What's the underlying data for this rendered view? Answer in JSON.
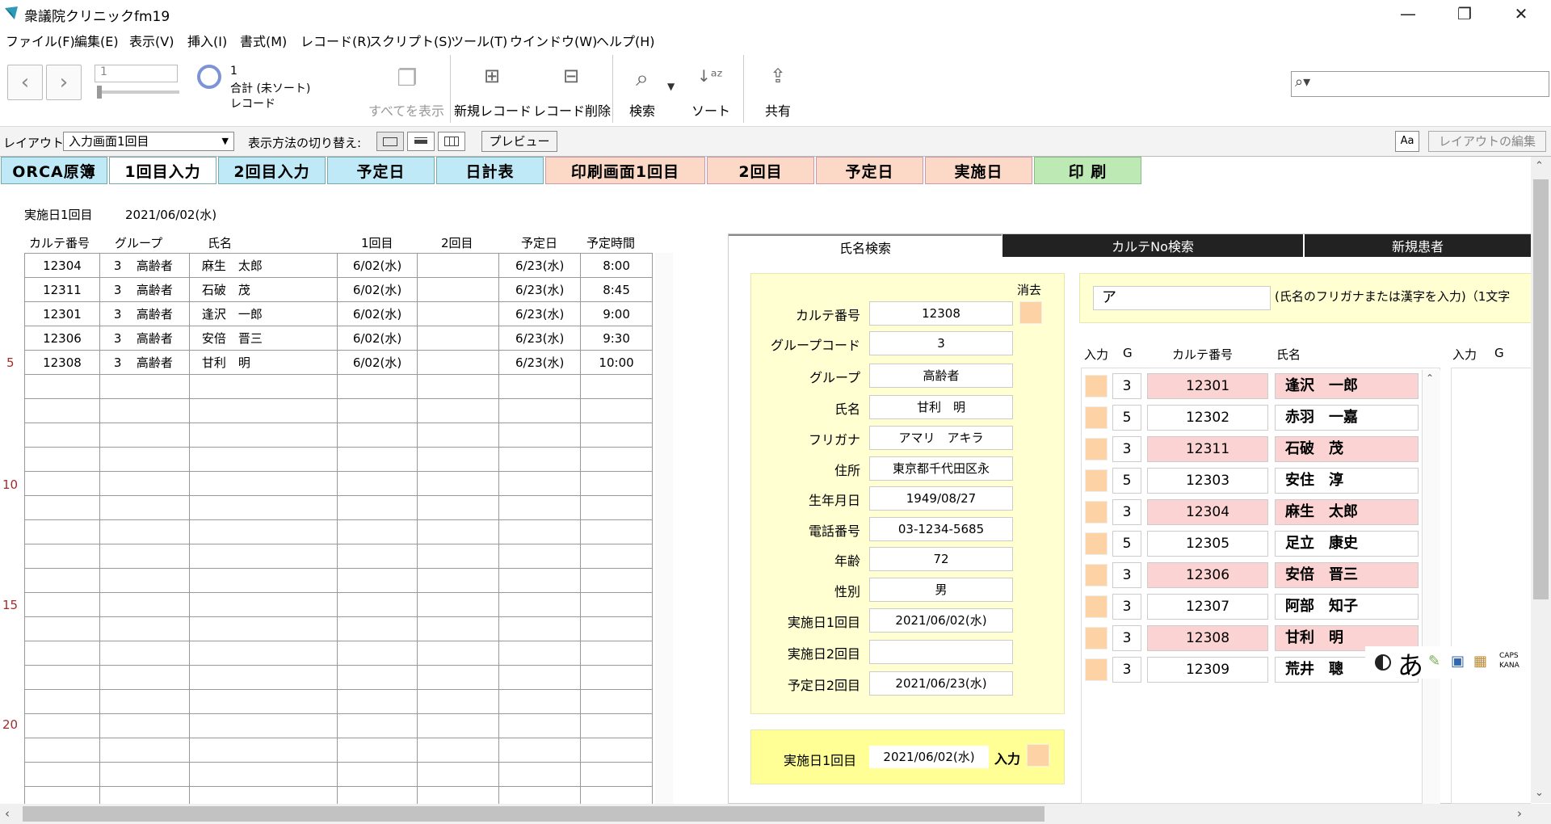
{
  "window": {
    "title": "衆議院クリニックfm19",
    "minimize": "—",
    "restore": "❐",
    "close": "✕"
  },
  "menu": [
    "ファイル(F)",
    "編集(E)",
    "表示(V)",
    "挿入(I)",
    "書式(M)",
    "レコード(R)",
    "スクリプト(S)",
    "ツール(T)",
    "ウインドウ(W)",
    "ヘルプ(H)"
  ],
  "toolbar": {
    "record_number": "1",
    "found_count": "1",
    "found_label": "合計 (未ソート)",
    "record_label": "レコード",
    "show_all": "すべてを表示",
    "new_record": "新規レコード",
    "delete_record": "レコード削除",
    "find": "検索",
    "sort": "ソート",
    "share": "共有",
    "search_placeholder": ""
  },
  "layoutbar": {
    "layout_label": "レイアウト:",
    "layout_value": "入力画面1回目",
    "view_switch_label": "表示方法の切り替え:",
    "preview": "プレビュー",
    "aa": "Aa",
    "edit_layout": "レイアウトの編集"
  },
  "nav_tabs": [
    "ORCA原簿",
    "1回目入力",
    "2回目入力",
    "予定日",
    "日計表",
    "印刷画面1回目",
    "2回目",
    "予定日",
    "実施日",
    "印 刷"
  ],
  "left": {
    "date_label": "実施日1回目",
    "date_value": "2021/06/02(水)",
    "headers": [
      "カルテ番号",
      "グループ",
      "氏名",
      "1回目",
      "2回目",
      "予定日",
      "予定時間"
    ],
    "rows": [
      {
        "karte": "12304",
        "g": "3",
        "group": "高齢者",
        "name": "麻生　太郎",
        "d1": "6/02(水)",
        "d2": "",
        "plan": "6/23(水)",
        "time": "8:00"
      },
      {
        "karte": "12311",
        "g": "3",
        "group": "高齢者",
        "name": "石破　茂",
        "d1": "6/02(水)",
        "d2": "",
        "plan": "6/23(水)",
        "time": "8:45"
      },
      {
        "karte": "12301",
        "g": "3",
        "group": "高齢者",
        "name": "逢沢　一郎",
        "d1": "6/02(水)",
        "d2": "",
        "plan": "6/23(水)",
        "time": "9:00"
      },
      {
        "karte": "12306",
        "g": "3",
        "group": "高齢者",
        "name": "安倍　晋三",
        "d1": "6/02(水)",
        "d2": "",
        "plan": "6/23(水)",
        "time": "9:30"
      },
      {
        "karte": "12308",
        "g": "3",
        "group": "高齢者",
        "name": "甘利　明",
        "d1": "6/02(水)",
        "d2": "",
        "plan": "6/23(水)",
        "time": "10:00"
      }
    ],
    "row_numbers": [
      "5",
      "10",
      "15",
      "20"
    ]
  },
  "panel_tabs": [
    "氏名検索",
    "カルテNo検索",
    "新規患者"
  ],
  "form": {
    "clear_label": "消去",
    "fields": [
      {
        "label": "カルテ番号",
        "value": "12308"
      },
      {
        "label": "グループコード",
        "value": "3"
      },
      {
        "label": "グループ",
        "value": "高齢者"
      },
      {
        "label": "氏名",
        "value": "甘利　明"
      },
      {
        "label": "フリガナ",
        "value": "アマリ　アキラ"
      },
      {
        "label": "住所",
        "value": "東京都千代田区永"
      },
      {
        "label": "生年月日",
        "value": "1949/08/27"
      },
      {
        "label": "電話番号",
        "value": "03-1234-5685"
      },
      {
        "label": "年齢",
        "value": "72"
      },
      {
        "label": "性別",
        "value": "男"
      },
      {
        "label": "実施日1回目",
        "value": "2021/06/02(水)"
      },
      {
        "label": "実施日2回目",
        "value": ""
      },
      {
        "label": "予定日2回目",
        "value": "2021/06/23(水)"
      }
    ],
    "bottom_label": "実施日1回目",
    "bottom_value": "2021/06/02(水)",
    "bottom_input": "入力"
  },
  "search": {
    "value": "ア",
    "hint": "(氏名のフリガナまたは漢字を入力)（1文字",
    "headers": [
      "入力",
      "G",
      "カルテ番号",
      "氏名"
    ],
    "headers2": [
      "入力",
      "G"
    ],
    "rows": [
      {
        "g": "3",
        "karte": "12301",
        "name": "逢沢　一郎",
        "hl": true
      },
      {
        "g": "5",
        "karte": "12302",
        "name": "赤羽　一嘉",
        "hl": false
      },
      {
        "g": "3",
        "karte": "12311",
        "name": "石破　茂",
        "hl": true
      },
      {
        "g": "5",
        "karte": "12303",
        "name": "安住　淳",
        "hl": false
      },
      {
        "g": "3",
        "karte": "12304",
        "name": "麻生　太郎",
        "hl": true
      },
      {
        "g": "5",
        "karte": "12305",
        "name": "足立　康史",
        "hl": false
      },
      {
        "g": "3",
        "karte": "12306",
        "name": "安倍　晋三",
        "hl": true
      },
      {
        "g": "3",
        "karte": "12307",
        "name": "阿部　知子",
        "hl": false
      },
      {
        "g": "3",
        "karte": "12308",
        "name": "甘利　明",
        "hl": true
      },
      {
        "g": "3",
        "karte": "12309",
        "name": "荒井　聰",
        "hl": false
      }
    ]
  },
  "ime": {
    "mode": "あ",
    "caps": "CAPS",
    "kana": "KANA"
  }
}
